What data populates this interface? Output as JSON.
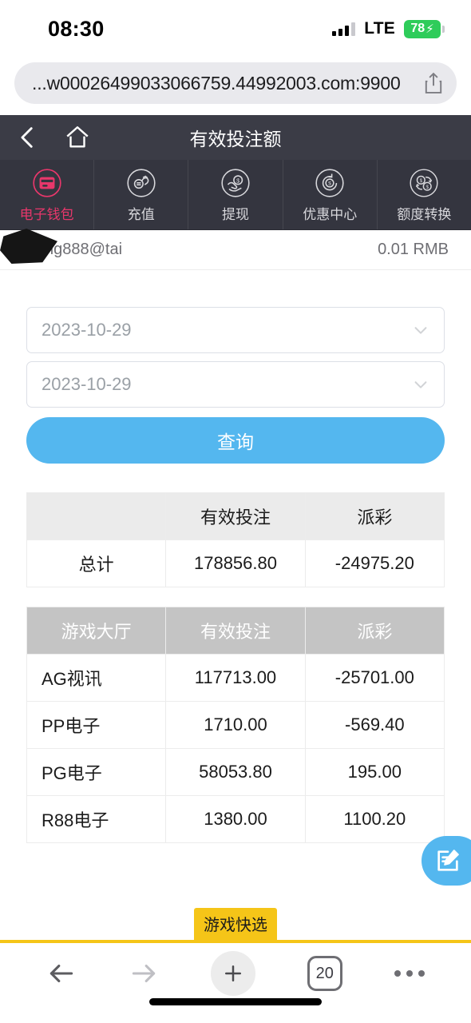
{
  "status_bar": {
    "time": "08:30",
    "network": "LTE",
    "battery_level": "78",
    "charging_glyph": "⚡",
    "signal_icon": "signal-bars-icon",
    "battery_icon": "battery-icon"
  },
  "browser": {
    "url": "...w00026499033066759.44992003.com:9900",
    "share_icon": "share-icon",
    "back_icon": "arrow-left-icon",
    "forward_icon": "arrow-right-icon",
    "new_tab_icon": "plus-icon",
    "tab_count": "20",
    "more_icon": "ellipsis-icon",
    "quick_tab_label": "游戏快选"
  },
  "app_header": {
    "title": "有效投注额",
    "back_icon": "chevron-left-icon",
    "home_icon": "home-icon"
  },
  "nav_tabs": {
    "active_color": "#e8376b",
    "items": [
      {
        "label": "电子钱包",
        "icon": "wallet-icon",
        "active": true
      },
      {
        "label": "充值",
        "icon": "deposit-hand-icon",
        "active": false
      },
      {
        "label": "提现",
        "icon": "withdraw-hand-dollar-icon",
        "active": false
      },
      {
        "label": "优惠中心",
        "icon": "promo-refresh-dollar-icon",
        "active": false
      },
      {
        "label": "额度转换",
        "icon": "transfer-coins-icon",
        "active": false
      }
    ]
  },
  "account": {
    "username": "ng888@tai",
    "balance": "0.01 RMB"
  },
  "form": {
    "start_date": "2023-10-29",
    "end_date": "2023-10-29",
    "chevron_icon": "chevron-down-icon",
    "query_label": "查询",
    "query_color": "#54b7ef"
  },
  "summary_table": {
    "headers": [
      "",
      "有效投注",
      "派彩"
    ],
    "rows": [
      {
        "name": "总计",
        "bet": "178856.80",
        "payout": "-24975.20"
      }
    ]
  },
  "detail_table": {
    "headers": [
      "游戏大厅",
      "有效投注",
      "派彩"
    ],
    "rows": [
      {
        "name": "AG视讯",
        "bet": "117713.00",
        "payout": "-25701.00"
      },
      {
        "name": "PP电子",
        "bet": "1710.00",
        "payout": "-569.40"
      },
      {
        "name": "PG电子",
        "bet": "58053.80",
        "payout": "195.00"
      },
      {
        "name": "R88电子",
        "bet": "1380.00",
        "payout": "1100.20"
      }
    ]
  },
  "fab": {
    "icon": "edit-note-icon"
  }
}
